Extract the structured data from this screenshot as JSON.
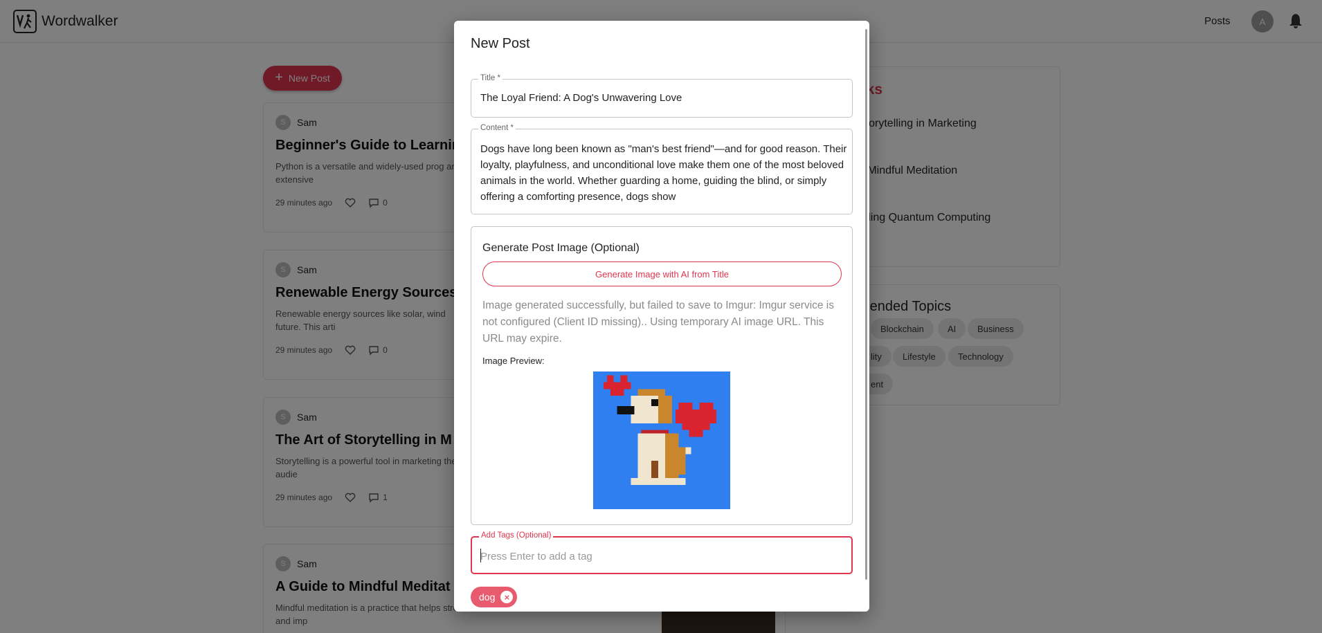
{
  "header": {
    "brand": "Wordwalker",
    "nav_posts": "Posts",
    "avatar_initial": "A"
  },
  "feed": {
    "new_post_label": "New Post",
    "posts": [
      {
        "author_initial": "S",
        "author": "Sam",
        "title": "Beginner's Guide to Learnin",
        "excerpt": "Python is a versatile and widely-used prog and extensive",
        "time": "29 minutes ago",
        "comments": "0"
      },
      {
        "author_initial": "S",
        "author": "Sam",
        "title": "Renewable Energy Sources:",
        "excerpt": "Renewable energy sources like solar, wind future. This arti",
        "time": "29 minutes ago",
        "comments": "0"
      },
      {
        "author_initial": "S",
        "author": "Sam",
        "title": "The Art of Storytelling in M",
        "excerpt": "Storytelling is a powerful tool in marketing the audie",
        "time": "29 minutes ago",
        "comments": "1"
      },
      {
        "author_initial": "S",
        "author": "Sam",
        "title": "A Guide to Mindful Meditat",
        "excerpt": "Mindful meditation is a practice that helps stress and imp",
        "time": "",
        "comments": ""
      }
    ]
  },
  "sidebar": {
    "picks_heading": "cks",
    "picks": [
      "Storytelling in Marketing",
      "o Mindful Meditation",
      "nding Quantum Computing"
    ],
    "topics_heading": "mended Topics",
    "topics": [
      "Blockchain",
      "AI",
      "Business",
      "lity",
      "Lifestyle",
      "Technology",
      "ent"
    ]
  },
  "modal": {
    "title": "New Post",
    "title_field": {
      "label": "Title *",
      "value": "The Loyal Friend: A Dog's Unwavering Love"
    },
    "content_field": {
      "label": "Content *",
      "value": "Dogs have long been known as \"man's best friend\"—and for good reason. Their loyalty, playfulness, and unconditional love make them one of the most beloved animals in the world. Whether guarding a home, guiding the blind, or simply offering a comforting presence, dogs show"
    },
    "image_section": {
      "heading": "Generate Post Image (Optional)",
      "button": "Generate Image with AI from Title",
      "message": "Image generated successfully, but failed to save to Imgur: Imgur service is not configured (Client ID missing).. Using temporary AI image URL. This URL may expire.",
      "preview_label": "Image Preview:"
    },
    "tags_field": {
      "label": "Add Tags (Optional)",
      "placeholder": "Press Enter to add a tag",
      "value": ""
    },
    "tags": [
      "dog"
    ]
  },
  "colors": {
    "accent": "#e0354e",
    "image_bg": "#2f7ff0"
  }
}
